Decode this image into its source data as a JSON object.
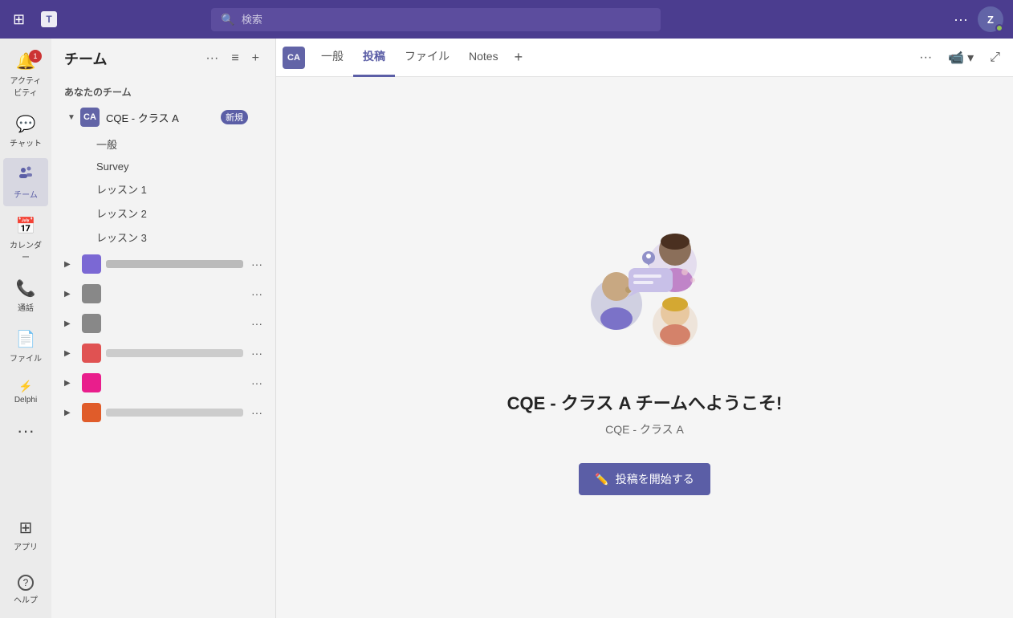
{
  "topbar": {
    "search_placeholder": "検索",
    "avatar_initials": "Z",
    "more_label": "···"
  },
  "left_nav": {
    "items": [
      {
        "id": "activity",
        "label": "アクティビティ",
        "icon": "🔔",
        "badge": "1"
      },
      {
        "id": "chat",
        "label": "チャット",
        "icon": "💬"
      },
      {
        "id": "teams",
        "label": "チーム",
        "icon": "👥",
        "active": true
      },
      {
        "id": "calendar",
        "label": "カレンダー",
        "icon": "📅"
      },
      {
        "id": "calls",
        "label": "通話",
        "icon": "📞"
      },
      {
        "id": "files",
        "label": "ファイル",
        "icon": "📄"
      },
      {
        "id": "delphi",
        "label": "Delphi",
        "icon": "⚡"
      },
      {
        "id": "more",
        "label": "···",
        "icon": "···"
      },
      {
        "id": "apps",
        "label": "アプリ",
        "icon": "⊞"
      }
    ],
    "bottom_items": [
      {
        "id": "help",
        "label": "ヘルプ",
        "icon": "?"
      }
    ]
  },
  "sidebar": {
    "title": "チーム",
    "your_teams_label": "あなたのチーム",
    "team": {
      "name": "CQE - クラス A",
      "avatar": "CA",
      "badge": "新規",
      "channels": [
        {
          "name": "一般"
        },
        {
          "name": "Survey"
        },
        {
          "name": "レッスン 1"
        },
        {
          "name": "レッスン 2"
        },
        {
          "name": "レッスン 3"
        }
      ]
    },
    "other_teams": [
      {
        "color": "#7b68d4",
        "text_width": "40%"
      },
      {
        "color": "#888",
        "text_width": "55%",
        "sub_text_width": "60%"
      },
      {
        "color": "#888",
        "text_width": "70%",
        "sub_text_width": "45%"
      },
      {
        "color": "#e05252",
        "text_width": "40%"
      },
      {
        "color": "#e91e8c",
        "text_width": "40%",
        "sub_text_width": "30%"
      },
      {
        "color": "#e05c2a",
        "text_width": "40%"
      }
    ]
  },
  "content": {
    "tabs": [
      {
        "id": "ippan",
        "label": "一般"
      },
      {
        "id": "tosho",
        "label": "投稿",
        "active": true
      },
      {
        "id": "files",
        "label": "ファイル"
      },
      {
        "id": "notes",
        "label": "Notes"
      }
    ],
    "welcome_title": "CQE - クラス A チームへようこそ!",
    "welcome_subtitle": "CQE - クラス A",
    "start_post_btn": "投稿を開始する",
    "channel_avatar": "CA"
  }
}
